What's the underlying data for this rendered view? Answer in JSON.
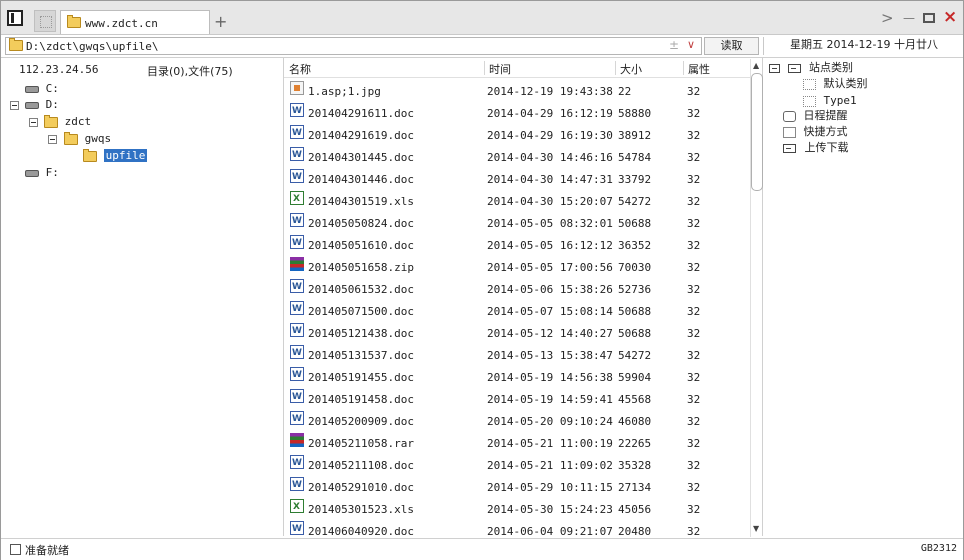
{
  "tab": {
    "label": "www.zdct.cn"
  },
  "new_tab_symbol": "+",
  "window_controls": {
    "forward": ">",
    "minimize": "—",
    "close": "×"
  },
  "address": {
    "value": "D:\\zdct\\gwqs\\upfile\\",
    "plus": "±",
    "dropdown": "∨"
  },
  "read_button": "读取",
  "date_display": "星期五 2014-12-19 十月廿八",
  "left_header": {
    "ip": "112.23.24.56",
    "counts": "目录(0),文件(75)"
  },
  "tree": [
    {
      "label": "C:",
      "type": "drive"
    },
    {
      "label": "D:",
      "type": "drive"
    },
    {
      "label": "zdct",
      "type": "folder"
    },
    {
      "label": "gwqs",
      "type": "folder"
    },
    {
      "label": "upfile",
      "type": "folder",
      "selected": true
    },
    {
      "label": "F:",
      "type": "drive"
    }
  ],
  "list_columns": [
    "名称",
    "时间",
    "大小",
    "属性"
  ],
  "files": [
    {
      "name": "1.asp;1.jpg",
      "time": "2014-12-19 19:43:38",
      "size": "22",
      "attr": "32",
      "icon": "image"
    },
    {
      "name": "201404291611.doc",
      "time": "2014-04-29 16:12:19",
      "size": "58880",
      "attr": "32",
      "icon": "doc"
    },
    {
      "name": "201404291619.doc",
      "time": "2014-04-29 16:19:30",
      "size": "38912",
      "attr": "32",
      "icon": "doc"
    },
    {
      "name": "201404301445.doc",
      "time": "2014-04-30 14:46:16",
      "size": "54784",
      "attr": "32",
      "icon": "doc"
    },
    {
      "name": "201404301446.doc",
      "time": "2014-04-30 14:47:31",
      "size": "33792",
      "attr": "32",
      "icon": "doc"
    },
    {
      "name": "201404301519.xls",
      "time": "2014-04-30 15:20:07",
      "size": "54272",
      "attr": "32",
      "icon": "xls"
    },
    {
      "name": "201405050824.doc",
      "time": "2014-05-05 08:32:01",
      "size": "50688",
      "attr": "32",
      "icon": "doc"
    },
    {
      "name": "201405051610.doc",
      "time": "2014-05-05 16:12:12",
      "size": "36352",
      "attr": "32",
      "icon": "doc"
    },
    {
      "name": "201405051658.zip",
      "time": "2014-05-05 17:00:56",
      "size": "70030",
      "attr": "32",
      "icon": "archive"
    },
    {
      "name": "201405061532.doc",
      "time": "2014-05-06 15:38:26",
      "size": "52736",
      "attr": "32",
      "icon": "doc"
    },
    {
      "name": "201405071500.doc",
      "time": "2014-05-07 15:08:14",
      "size": "50688",
      "attr": "32",
      "icon": "doc"
    },
    {
      "name": "201405121438.doc",
      "time": "2014-05-12 14:40:27",
      "size": "50688",
      "attr": "32",
      "icon": "doc"
    },
    {
      "name": "201405131537.doc",
      "time": "2014-05-13 15:38:47",
      "size": "54272",
      "attr": "32",
      "icon": "doc"
    },
    {
      "name": "201405191455.doc",
      "time": "2014-05-19 14:56:38",
      "size": "59904",
      "attr": "32",
      "icon": "doc"
    },
    {
      "name": "201405191458.doc",
      "time": "2014-05-19 14:59:41",
      "size": "45568",
      "attr": "32",
      "icon": "doc"
    },
    {
      "name": "201405200909.doc",
      "time": "2014-05-20 09:10:24",
      "size": "46080",
      "attr": "32",
      "icon": "doc"
    },
    {
      "name": "201405211058.rar",
      "time": "2014-05-21 11:00:19",
      "size": "22265",
      "attr": "32",
      "icon": "archive"
    },
    {
      "name": "201405211108.doc",
      "time": "2014-05-21 11:09:02",
      "size": "35328",
      "attr": "32",
      "icon": "doc"
    },
    {
      "name": "201405291010.doc",
      "time": "2014-05-29 10:11:15",
      "size": "27134",
      "attr": "32",
      "icon": "doc"
    },
    {
      "name": "201405301523.xls",
      "time": "2014-05-30 15:24:23",
      "size": "45056",
      "attr": "32",
      "icon": "xls"
    },
    {
      "name": "201406040920.doc",
      "time": "2014-06-04 09:21:07",
      "size": "20480",
      "attr": "32",
      "icon": "doc"
    }
  ],
  "right_tree": {
    "site_categories": "站点类别",
    "default_category": "默认类别",
    "type1": "Type1",
    "schedule": "日程提醒",
    "shortcuts": "快捷方式",
    "upload_download": "上传下载"
  },
  "status": {
    "text": "准备就绪",
    "encoding": "GB2312"
  }
}
